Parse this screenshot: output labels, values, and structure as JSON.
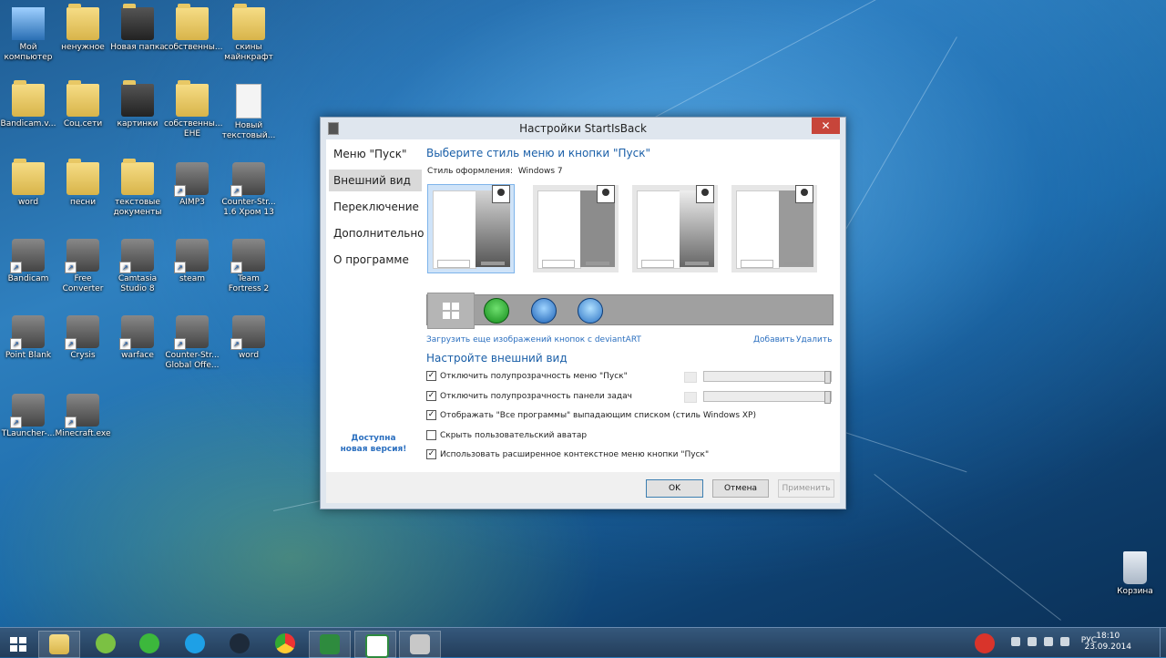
{
  "desktop": {
    "icons": [
      {
        "label": "Мой компьютер",
        "type": "computer"
      },
      {
        "label": "ненужное",
        "type": "folder"
      },
      {
        "label": "Новая папка",
        "type": "folder-dark"
      },
      {
        "label": "собственны...",
        "type": "folder"
      },
      {
        "label": "скины майнкрафт",
        "type": "folder"
      },
      {
        "label": "Bandicam.v...",
        "type": "folder"
      },
      {
        "label": "Соц.сети",
        "type": "folder"
      },
      {
        "label": "картинки",
        "type": "folder-dark"
      },
      {
        "label": "собственны... EHE",
        "type": "folder"
      },
      {
        "label": "Новый текстовый...",
        "type": "text-document"
      },
      {
        "label": "word",
        "type": "folder-doc"
      },
      {
        "label": "песни",
        "type": "folder"
      },
      {
        "label": "текстовые документы",
        "type": "folder"
      },
      {
        "label": "AIMP3",
        "type": "app"
      },
      {
        "label": "Counter-Str... 1.6 Хром 13",
        "type": "app"
      },
      {
        "label": "Bandicam",
        "type": "app"
      },
      {
        "label": "Free Converter",
        "type": "app"
      },
      {
        "label": "Camtasia Studio 8",
        "type": "app"
      },
      {
        "label": "steam",
        "type": "app"
      },
      {
        "label": "Team Fortress 2",
        "type": "app"
      },
      {
        "label": "Point Blank",
        "type": "app"
      },
      {
        "label": "Crysis",
        "type": "app"
      },
      {
        "label": "warface",
        "type": "app"
      },
      {
        "label": "Counter-Str... Global Offe...",
        "type": "app"
      },
      {
        "label": "word",
        "type": "app"
      },
      {
        "label": "TLauncher-...",
        "type": "app"
      },
      {
        "label": "Minecraft.exe",
        "type": "app"
      }
    ],
    "recycle_bin": "Корзина"
  },
  "dialog": {
    "title": "Настройки StartIsBack",
    "nav": [
      "Меню \"Пуск\"",
      "Внешний вид",
      "Переключение",
      "Дополнительно",
      "О программе"
    ],
    "active_nav": "Внешний вид",
    "new_version": "Доступна новая версия!",
    "heading1": "Выберите стиль меню и кнопки \"Пуск\"",
    "style_label": "Стиль оформления:",
    "style_value": "Windows 7",
    "load_more": "Загрузить еще изображений кнопок с deviantART",
    "add": "Добавить",
    "remove": "Удалить",
    "heading2": "Настройте внешний вид",
    "options": [
      {
        "label": "Отключить полупрозрачность меню \"Пуск\"",
        "checked": true
      },
      {
        "label": "Отключить полупрозрачность панели задач",
        "checked": true
      },
      {
        "label": "Отображать \"Все программы\" выпадающим списком (стиль Windows XP)",
        "checked": true
      },
      {
        "label": "Скрыть пользовательский аватар",
        "checked": false
      },
      {
        "label": "Использовать расширенное контекстное меню кнопки \"Пуск\"",
        "checked": true
      }
    ],
    "ok": "OK",
    "cancel": "Отмена",
    "apply": "Применить"
  },
  "taskbar": {
    "language": "РУС",
    "time": "18:10",
    "date": "23.09.2014",
    "apps": [
      "start",
      "explorer",
      "utorrent",
      "agent",
      "skype",
      "steam",
      "chrome",
      "camtasia",
      "camtasia-recorder",
      "startisback"
    ]
  }
}
